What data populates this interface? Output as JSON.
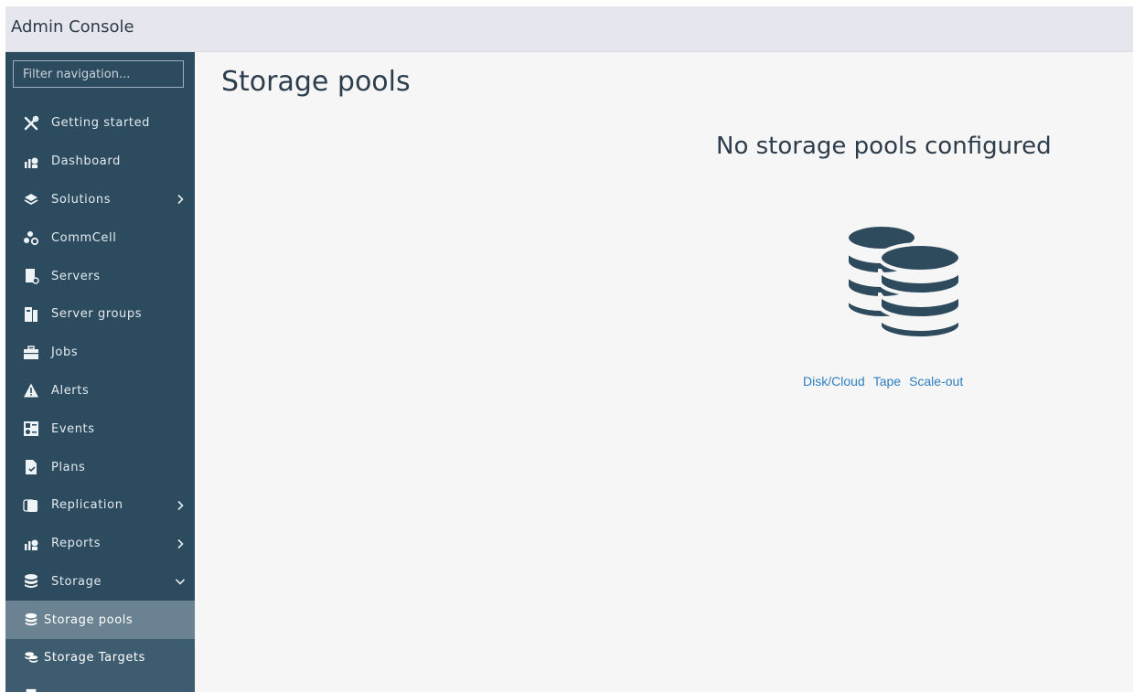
{
  "header": {
    "app_title": "Admin Console"
  },
  "sidebar": {
    "filter_placeholder": "Filter navigation...",
    "items": [
      {
        "label": "Getting started",
        "icon": "tools-icon"
      },
      {
        "label": "Dashboard",
        "icon": "dashboard-icon"
      },
      {
        "label": "Solutions",
        "icon": "layers-icon",
        "has_submenu": true
      },
      {
        "label": "CommCell",
        "icon": "commcell-icon"
      },
      {
        "label": "Servers",
        "icon": "server-icon"
      },
      {
        "label": "Server groups",
        "icon": "server-groups-icon"
      },
      {
        "label": "Jobs",
        "icon": "briefcase-icon"
      },
      {
        "label": "Alerts",
        "icon": "warning-icon"
      },
      {
        "label": "Events",
        "icon": "events-icon"
      },
      {
        "label": "Plans",
        "icon": "plans-icon"
      },
      {
        "label": "Replication",
        "icon": "replication-icon",
        "has_submenu": true
      },
      {
        "label": "Reports",
        "icon": "reports-icon",
        "has_submenu": true
      },
      {
        "label": "Storage",
        "icon": "database-icon",
        "expanded": true
      }
    ],
    "storage_subitems": [
      {
        "label": "Storage pools",
        "icon": "database-icon",
        "active": true
      },
      {
        "label": "Storage Targets",
        "icon": "storage-targets-icon"
      }
    ]
  },
  "main": {
    "page_title": "Storage pools",
    "empty_state": {
      "title": "No storage pools configured",
      "icon": "databases-icon",
      "links": [
        "Disk/Cloud",
        "Tape",
        "Scale-out"
      ]
    }
  },
  "colors": {
    "sidebar_bg": "#2d4b5f",
    "active_item_bg": "#6a8292",
    "link": "#2c7fc2",
    "topbar_bg": "#e6e6ee",
    "db_icon": "#2e4b5e"
  }
}
